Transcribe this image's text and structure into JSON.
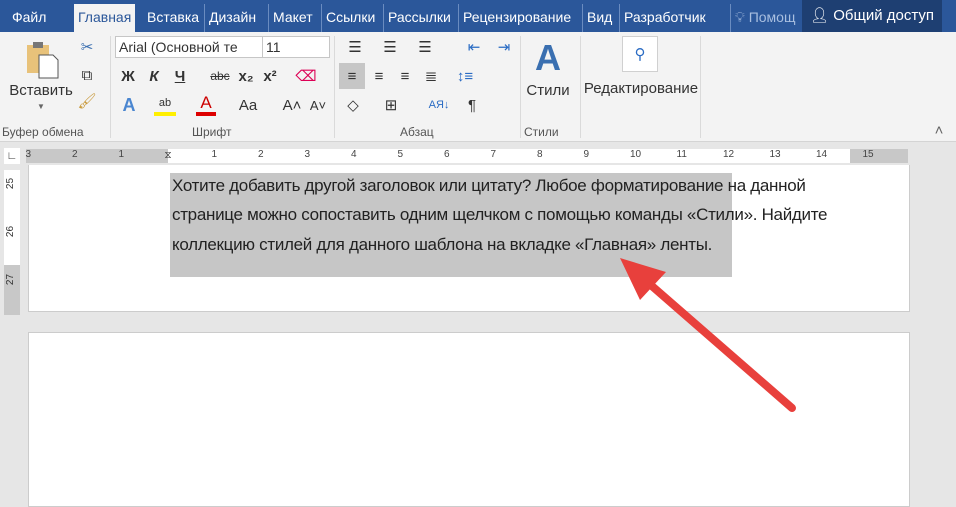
{
  "tabs": [
    "Файл",
    "Главная",
    "Вставка",
    "Дизайн",
    "Макет",
    "Ссылки",
    "Рассылки",
    "Рецензирование",
    "Вид",
    "Разработчик"
  ],
  "tell_me": "Помощ",
  "share": "Общий доступ",
  "clipboard": {
    "paste": "Вставить",
    "label": "Буфер обмена"
  },
  "font": {
    "name": "Arial (Основной те",
    "size": "11",
    "label": "Шрифт",
    "bold": "Ж",
    "italic": "К",
    "underline": "Ч",
    "strike": "abc",
    "sub": "x₂",
    "sup": "x²",
    "case": "Aa"
  },
  "paragraph": {
    "label": "Абзац"
  },
  "styles": {
    "button": "Стили",
    "label": "Стили"
  },
  "editing": {
    "button": "Редактирование"
  },
  "ruler": {
    "numbers": [
      "3",
      "2",
      "1",
      "1",
      "2",
      "3",
      "4",
      "5",
      "6",
      "7",
      "8",
      "9",
      "10",
      "11",
      "12",
      "13",
      "14",
      "15"
    ],
    "vertical": [
      "25",
      "26",
      "27"
    ]
  },
  "document": {
    "lines": [
      "Хотите добавить другой заголовок или цитату? Любое форматирование на данной",
      "странице можно сопоставить одним щелчком с помощью команды «Стили». Найдите",
      "коллекцию стилей для данного шаблона на вкладке «Главная» ленты."
    ]
  },
  "colors": {
    "accent": "#2b579a",
    "arrow": "#e8403c",
    "selection": "#c6c6c6"
  }
}
